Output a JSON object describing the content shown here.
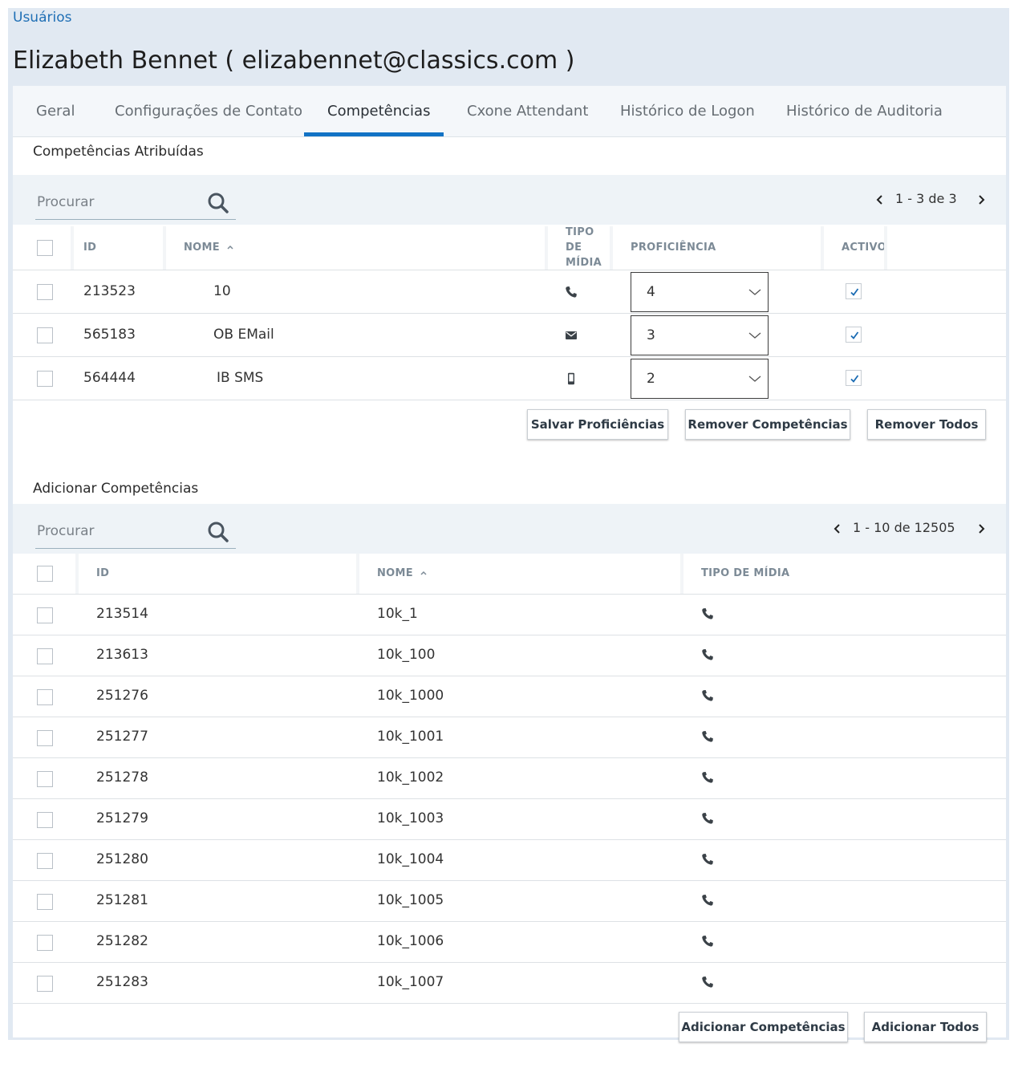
{
  "breadcrumb": "Usuários",
  "page_title": "Elizabeth Bennet ( elizabennet@classics.com )",
  "tabs": [
    {
      "label": "Geral",
      "active": false
    },
    {
      "label": "Configurações de Contato",
      "active": false
    },
    {
      "label": "Competências",
      "active": true
    },
    {
      "label": "Cxone Attendant",
      "active": false
    },
    {
      "label": "Histórico de Logon",
      "active": false
    },
    {
      "label": "Histórico de Auditoria",
      "active": false
    }
  ],
  "assigned": {
    "title": "Competências Atribuídas",
    "search_placeholder": "Procurar",
    "pager": "1 - 3 de 3",
    "headers": {
      "id": "ID",
      "name": "NOME",
      "media_line1": "TIPO",
      "media_line2": "DE",
      "media_line3": "MÍDIA",
      "proficiency": "PROFICIÊNCIA",
      "active": "ACTIVO"
    },
    "rows": [
      {
        "id": "213523",
        "name": "10",
        "media": "phone-icon",
        "proficiency": "4",
        "active": true
      },
      {
        "id": "565183",
        "name": "OB EMail",
        "media": "email-icon",
        "proficiency": "3",
        "active": true
      },
      {
        "id": "564444",
        "name": "IB SMS",
        "media": "mobile-icon",
        "proficiency": "2",
        "active": true
      }
    ],
    "buttons": {
      "save": "Salvar Proficiências",
      "remove": "Remover Competências",
      "remove_all": "Remover Todos"
    }
  },
  "add": {
    "title": "Adicionar Competências",
    "search_placeholder": "Procurar",
    "pager": "1 - 10 de 12505",
    "headers": {
      "id": "ID",
      "name": "NOME",
      "media": "TIPO DE MÍDIA"
    },
    "rows": [
      {
        "id": "213514",
        "name": "10k_1",
        "media": "phone-icon"
      },
      {
        "id": "213613",
        "name": "10k_100",
        "media": "phone-icon"
      },
      {
        "id": "251276",
        "name": "10k_1000",
        "media": "phone-icon"
      },
      {
        "id": "251277",
        "name": "10k_1001",
        "media": "phone-icon"
      },
      {
        "id": "251278",
        "name": "10k_1002",
        "media": "phone-icon"
      },
      {
        "id": "251279",
        "name": "10k_1003",
        "media": "phone-icon"
      },
      {
        "id": "251280",
        "name": "10k_1004",
        "media": "phone-icon"
      },
      {
        "id": "251281",
        "name": "10k_1005",
        "media": "phone-icon"
      },
      {
        "id": "251282",
        "name": "10k_1006",
        "media": "phone-icon"
      },
      {
        "id": "251283",
        "name": "10k_1007",
        "media": "phone-icon"
      }
    ],
    "buttons": {
      "add": "Adicionar Competências",
      "add_all": "Adicionar Todos"
    }
  },
  "colors": {
    "accent": "#1273c5",
    "link": "#1f6fb5",
    "header_bg": "#e1e9f2",
    "toolbar_bg": "#eef3f7"
  }
}
